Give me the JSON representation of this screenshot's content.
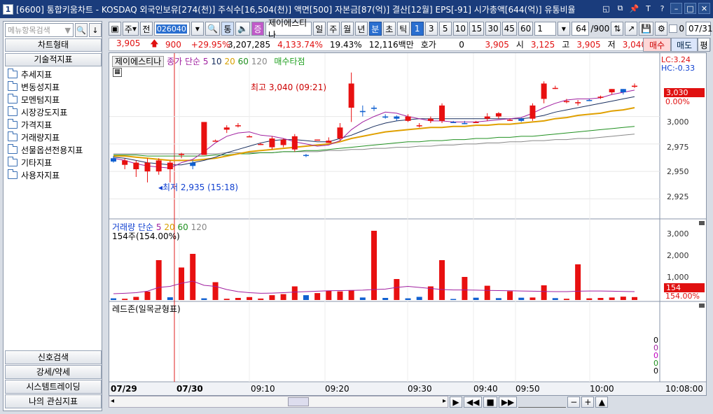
{
  "titlebar": {
    "badge": "1",
    "title": "[6600] 통합키움차트 - KOSDAQ 외국인보유[274(천)] 주식수[16,504(천)] 액면[500] 자본금[87(억)] 결산[12월] EPS[-91] 시가총액[644(억)] 유통비율"
  },
  "left_panel": {
    "search_placeholder": "메뉴항목검색",
    "tabs": [
      "차트형태",
      "기술적지표"
    ],
    "tree_items": [
      "추세지표",
      "변동성지표",
      "모멘텀지표",
      "시장강도지표",
      "가격지표",
      "거래량지표",
      "선물옵션전용지표",
      "기타지표",
      "사용자지표"
    ],
    "bottom_tabs": [
      "신호검색",
      "강세/약세",
      "시스템트레이딩",
      "나의 관심지표"
    ]
  },
  "toolbar": {
    "period_label": "주",
    "prev_label": "전",
    "code": "026040",
    "tong_label": "통",
    "jeung_label": "증",
    "stock_name": "제이에스티나",
    "period_buttons": [
      "일",
      "주",
      "월",
      "년",
      "분",
      "초",
      "틱"
    ],
    "selected_period": "분",
    "minute_buttons": [
      "1",
      "3",
      "5",
      "10",
      "15",
      "30",
      "45",
      "60"
    ],
    "selected_minute": "1",
    "interval_value": "1",
    "count_value": "64",
    "count_total": "/900",
    "checkbox_label": "0",
    "date_value": "07/31"
  },
  "pricebar": {
    "price": "3,905",
    "change": "900",
    "change_pct": "+29.95%",
    "volume": "3,207,285",
    "volume_pct": "4,133.74%",
    "turnover": "19.43%",
    "amount": "12,116백만",
    "hoga_label": "호가",
    "hoga_value": "0",
    "current": "3,905",
    "open_label": "시",
    "open": "3,125",
    "high_label": "고",
    "high": "3,905",
    "low_label": "저",
    "low": "3,040",
    "buy_label": "매수",
    "sell_label": "매도",
    "avg_label": "평"
  },
  "price_pane": {
    "legend_name": "제이에스티나",
    "legend_ma": "종가 단순",
    "ma_periods": [
      "5",
      "10",
      "20",
      "60",
      "120"
    ],
    "signal": "매수타점",
    "lc": "LC:3.24",
    "hc": "HC:-0.33",
    "high_annotation": "최고 3,040 (09:21)",
    "low_annotation": "최저 2,935 (15:18)",
    "last_price_tag": "3,030",
    "last_pct_tag": "0.00%",
    "y_ticks": [
      "3,000",
      "2,975",
      "2,950",
      "2,925"
    ]
  },
  "volume_pane": {
    "legend_name": "거래량",
    "legend_ma": "단순",
    "ma_periods": [
      "5",
      "20",
      "60",
      "120"
    ],
    "value_label": "154주(154.00%)",
    "last_tag": "154",
    "last_pct": "154.00%",
    "y_ticks": [
      "3,000",
      "2,000",
      "1,000"
    ]
  },
  "redzone_pane": {
    "legend_name": "레드존(일목균형표)",
    "values": [
      "0",
      "0",
      "0",
      "0",
      "0"
    ]
  },
  "time_axis": {
    "labels": [
      "07/29",
      "07/30",
      "09:10",
      "09:20",
      "09:30",
      "09:40",
      "09:50",
      "10:00"
    ],
    "cursor_time": "10:08:00"
  },
  "chart_data": {
    "type": "candlestick",
    "title": "제이에스티나",
    "ylim": [
      2910,
      3050
    ],
    "candles": [
      {
        "o": 2962,
        "h": 2964,
        "l": 2958,
        "c": 2959,
        "up": false
      },
      {
        "o": 2960,
        "h": 2962,
        "l": 2952,
        "c": 2956,
        "up": true
      },
      {
        "o": 2958,
        "h": 2960,
        "l": 2945,
        "c": 2952,
        "up": true
      },
      {
        "o": 2958,
        "h": 2962,
        "l": 2940,
        "c": 2950,
        "up": true
      },
      {
        "o": 2960,
        "h": 2962,
        "l": 2947,
        "c": 2950,
        "up": true
      },
      {
        "o": 2958,
        "h": 2960,
        "l": 2940,
        "c": 2952,
        "up": true
      },
      {
        "o": 2966,
        "h": 2967,
        "l": 2962,
        "c": 2965,
        "up": true
      },
      {
        "o": 2958,
        "h": 2960,
        "l": 2952,
        "c": 2955,
        "up": false
      },
      {
        "o": 2965,
        "h": 2995,
        "l": 2965,
        "c": 2995,
        "up": true
      },
      {
        "o": 2978,
        "h": 2979,
        "l": 2978,
        "c": 2978,
        "up": true
      },
      {
        "o": 2990,
        "h": 2992,
        "l": 2985,
        "c": 2988,
        "up": true
      },
      {
        "o": 2992,
        "h": 2994,
        "l": 2990,
        "c": 2992,
        "up": true
      },
      {
        "o": 2982,
        "h": 2983,
        "l": 2982,
        "c": 2982,
        "up": true
      },
      {
        "o": 2975,
        "h": 2976,
        "l": 2974,
        "c": 2975,
        "up": true
      },
      {
        "o": 2980,
        "h": 2982,
        "l": 2970,
        "c": 2972,
        "up": true
      },
      {
        "o": 2979,
        "h": 2980,
        "l": 2972,
        "c": 2974,
        "up": true
      },
      {
        "o": 2982,
        "h": 2984,
        "l": 2968,
        "c": 2970,
        "up": true
      },
      {
        "o": 2965,
        "h": 2966,
        "l": 2963,
        "c": 2965,
        "up": false
      },
      {
        "o": 2979,
        "h": 2979,
        "l": 2979,
        "c": 2979,
        "up": true
      },
      {
        "o": 2978,
        "h": 2981,
        "l": 2976,
        "c": 2976,
        "up": true
      },
      {
        "o": 2990,
        "h": 2994,
        "l": 2978,
        "c": 2980,
        "up": true
      },
      {
        "o": 3030,
        "h": 3040,
        "l": 2995,
        "c": 3008,
        "up": true
      },
      {
        "o": 3005,
        "h": 3010,
        "l": 3000,
        "c": 3004,
        "up": false
      },
      {
        "o": 3008,
        "h": 3010,
        "l": 3005,
        "c": 3007,
        "up": false
      },
      {
        "o": 3000,
        "h": 3002,
        "l": 2998,
        "c": 2999,
        "up": false
      },
      {
        "o": 3000,
        "h": 3001,
        "l": 2996,
        "c": 2998,
        "up": false
      },
      {
        "o": 3000,
        "h": 3002,
        "l": 2995,
        "c": 2996,
        "up": true
      },
      {
        "o": 2992,
        "h": 2994,
        "l": 2990,
        "c": 2992,
        "up": true
      },
      {
        "o": 2998,
        "h": 3000,
        "l": 2994,
        "c": 2996,
        "up": true
      },
      {
        "o": 3010,
        "h": 3012,
        "l": 2994,
        "c": 2996,
        "up": true
      },
      {
        "o": 2995,
        "h": 2996,
        "l": 2994,
        "c": 2995,
        "up": false
      },
      {
        "o": 2994,
        "h": 2996,
        "l": 2993,
        "c": 2994,
        "up": false
      },
      {
        "o": 2995,
        "h": 2996,
        "l": 2994,
        "c": 2995,
        "up": true
      },
      {
        "o": 3000,
        "h": 3003,
        "l": 2996,
        "c": 2998,
        "up": true
      },
      {
        "o": 3003,
        "h": 3004,
        "l": 2998,
        "c": 3000,
        "up": true
      },
      {
        "o": 2997,
        "h": 2998,
        "l": 2996,
        "c": 2997,
        "up": true
      },
      {
        "o": 2998,
        "h": 2999,
        "l": 2995,
        "c": 2996,
        "up": false
      },
      {
        "o": 3010,
        "h": 3012,
        "l": 2996,
        "c": 2998,
        "up": true
      },
      {
        "o": 3030,
        "h": 3032,
        "l": 3012,
        "c": 3016,
        "up": true
      },
      {
        "o": 3026,
        "h": 3028,
        "l": 3025,
        "c": 3026,
        "up": true
      },
      {
        "o": 3014,
        "h": 3016,
        "l": 3012,
        "c": 3014,
        "up": true
      },
      {
        "o": 3012,
        "h": 3015,
        "l": 3010,
        "c": 3013,
        "up": true
      },
      {
        "o": 3015,
        "h": 3016,
        "l": 3014,
        "c": 3015,
        "up": false
      },
      {
        "o": 3017,
        "h": 3019,
        "l": 3016,
        "c": 3018,
        "up": true
      },
      {
        "o": 3022,
        "h": 3025,
        "l": 3020,
        "c": 3025,
        "up": true
      },
      {
        "o": 3022,
        "h": 3025,
        "l": 3020,
        "c": 3025,
        "up": false
      },
      {
        "o": 3028,
        "h": 3030,
        "l": 3026,
        "c": 3027,
        "up": true
      }
    ],
    "ma5": [
      2962,
      2960,
      2957,
      2955,
      2954,
      2953,
      2958,
      2961,
      2968,
      2976,
      2982,
      2985,
      2986,
      2983,
      2982,
      2980,
      2977,
      2975,
      2973,
      2974,
      2978,
      2988,
      2995,
      3000,
      3004,
      3003,
      3000,
      2998,
      2996,
      2996,
      2995,
      2995,
      2995,
      2996,
      2997,
      2998,
      2999,
      3003,
      3008,
      3012,
      3015,
      3016,
      3016,
      3017,
      3020,
      3022,
      3024
    ],
    "ma10": [
      2963,
      2962,
      2960,
      2958,
      2957,
      2956,
      2956,
      2958,
      2960,
      2963,
      2967,
      2970,
      2973,
      2976,
      2978,
      2979,
      2979,
      2978,
      2977,
      2977,
      2980,
      2983,
      2987,
      2991,
      2994,
      2996,
      2997,
      2998,
      2998,
      2998,
      2998,
      2998,
      2998,
      2998,
      2998,
      2998,
      2998,
      2999,
      3001,
      3004,
      3006,
      3008,
      3010,
      3012,
      3014,
      3016,
      3018
    ],
    "ma20": [
      2964,
      2964,
      2963,
      2962,
      2961,
      2960,
      2960,
      2960,
      2961,
      2962,
      2964,
      2966,
      2968,
      2969,
      2970,
      2971,
      2972,
      2973,
      2974,
      2975,
      2977,
      2980,
      2982,
      2984,
      2986,
      2987,
      2988,
      2989,
      2990,
      2990,
      2991,
      2991,
      2992,
      2992,
      2993,
      2993,
      2994,
      2995,
      2996,
      2998,
      2999,
      3001,
      3002,
      3003,
      3005,
      3006,
      3008
    ],
    "ma60": [
      2965,
      2965,
      2965,
      2964,
      2964,
      2964,
      2964,
      2964,
      2964,
      2965,
      2965,
      2966,
      2966,
      2967,
      2967,
      2968,
      2968,
      2969,
      2969,
      2970,
      2971,
      2972,
      2973,
      2974,
      2975,
      2976,
      2977,
      2977,
      2978,
      2978,
      2979,
      2979,
      2980,
      2980,
      2981,
      2981,
      2982,
      2982,
      2983,
      2984,
      2985,
      2986,
      2987,
      2988,
      2989,
      2990,
      2991
    ],
    "ma120": [
      2966,
      2966,
      2966,
      2966,
      2966,
      2966,
      2966,
      2966,
      2966,
      2966,
      2967,
      2967,
      2967,
      2967,
      2967,
      2968,
      2968,
      2968,
      2968,
      2969,
      2969,
      2970,
      2970,
      2971,
      2971,
      2972,
      2972,
      2973,
      2973,
      2974,
      2974,
      2975,
      2975,
      2976,
      2976,
      2977,
      2977,
      2978,
      2978,
      2979,
      2979,
      2980,
      2980,
      2981,
      2982,
      2983,
      2984
    ],
    "volume": [
      80,
      60,
      150,
      400,
      1900,
      130,
      1550,
      2200,
      80,
      850,
      60,
      100,
      140,
      70,
      230,
      280,
      650,
      230,
      330,
      450,
      410,
      470,
      120,
      3300,
      100,
      1000,
      80,
      150,
      650,
      1900,
      50,
      1100,
      110,
      680,
      90,
      420,
      110,
      120,
      700,
      90,
      60,
      1700,
      80,
      100,
      120,
      160,
      140
    ],
    "volume_up": [
      false,
      true,
      true,
      true,
      true,
      false,
      true,
      true,
      false,
      true,
      true,
      true,
      true,
      true,
      true,
      true,
      true,
      false,
      true,
      true,
      true,
      true,
      false,
      true,
      false,
      true,
      false,
      false,
      true,
      true,
      false,
      true,
      false,
      true,
      false,
      true,
      false,
      true,
      true,
      false,
      true,
      true,
      true,
      true,
      true,
      true,
      true
    ],
    "vol_ma": [
      300,
      320,
      350,
      420,
      600,
      650,
      800,
      900,
      700,
      650,
      500,
      400,
      350,
      320,
      330,
      350,
      380,
      400,
      420,
      440,
      450,
      460,
      470,
      500,
      520,
      600,
      650,
      600,
      550,
      500,
      480,
      480,
      470,
      460,
      450,
      440,
      430,
      420,
      410,
      400,
      400,
      420,
      430,
      430,
      420,
      410,
      400
    ],
    "vol_ylim": [
      0,
      3500
    ]
  }
}
